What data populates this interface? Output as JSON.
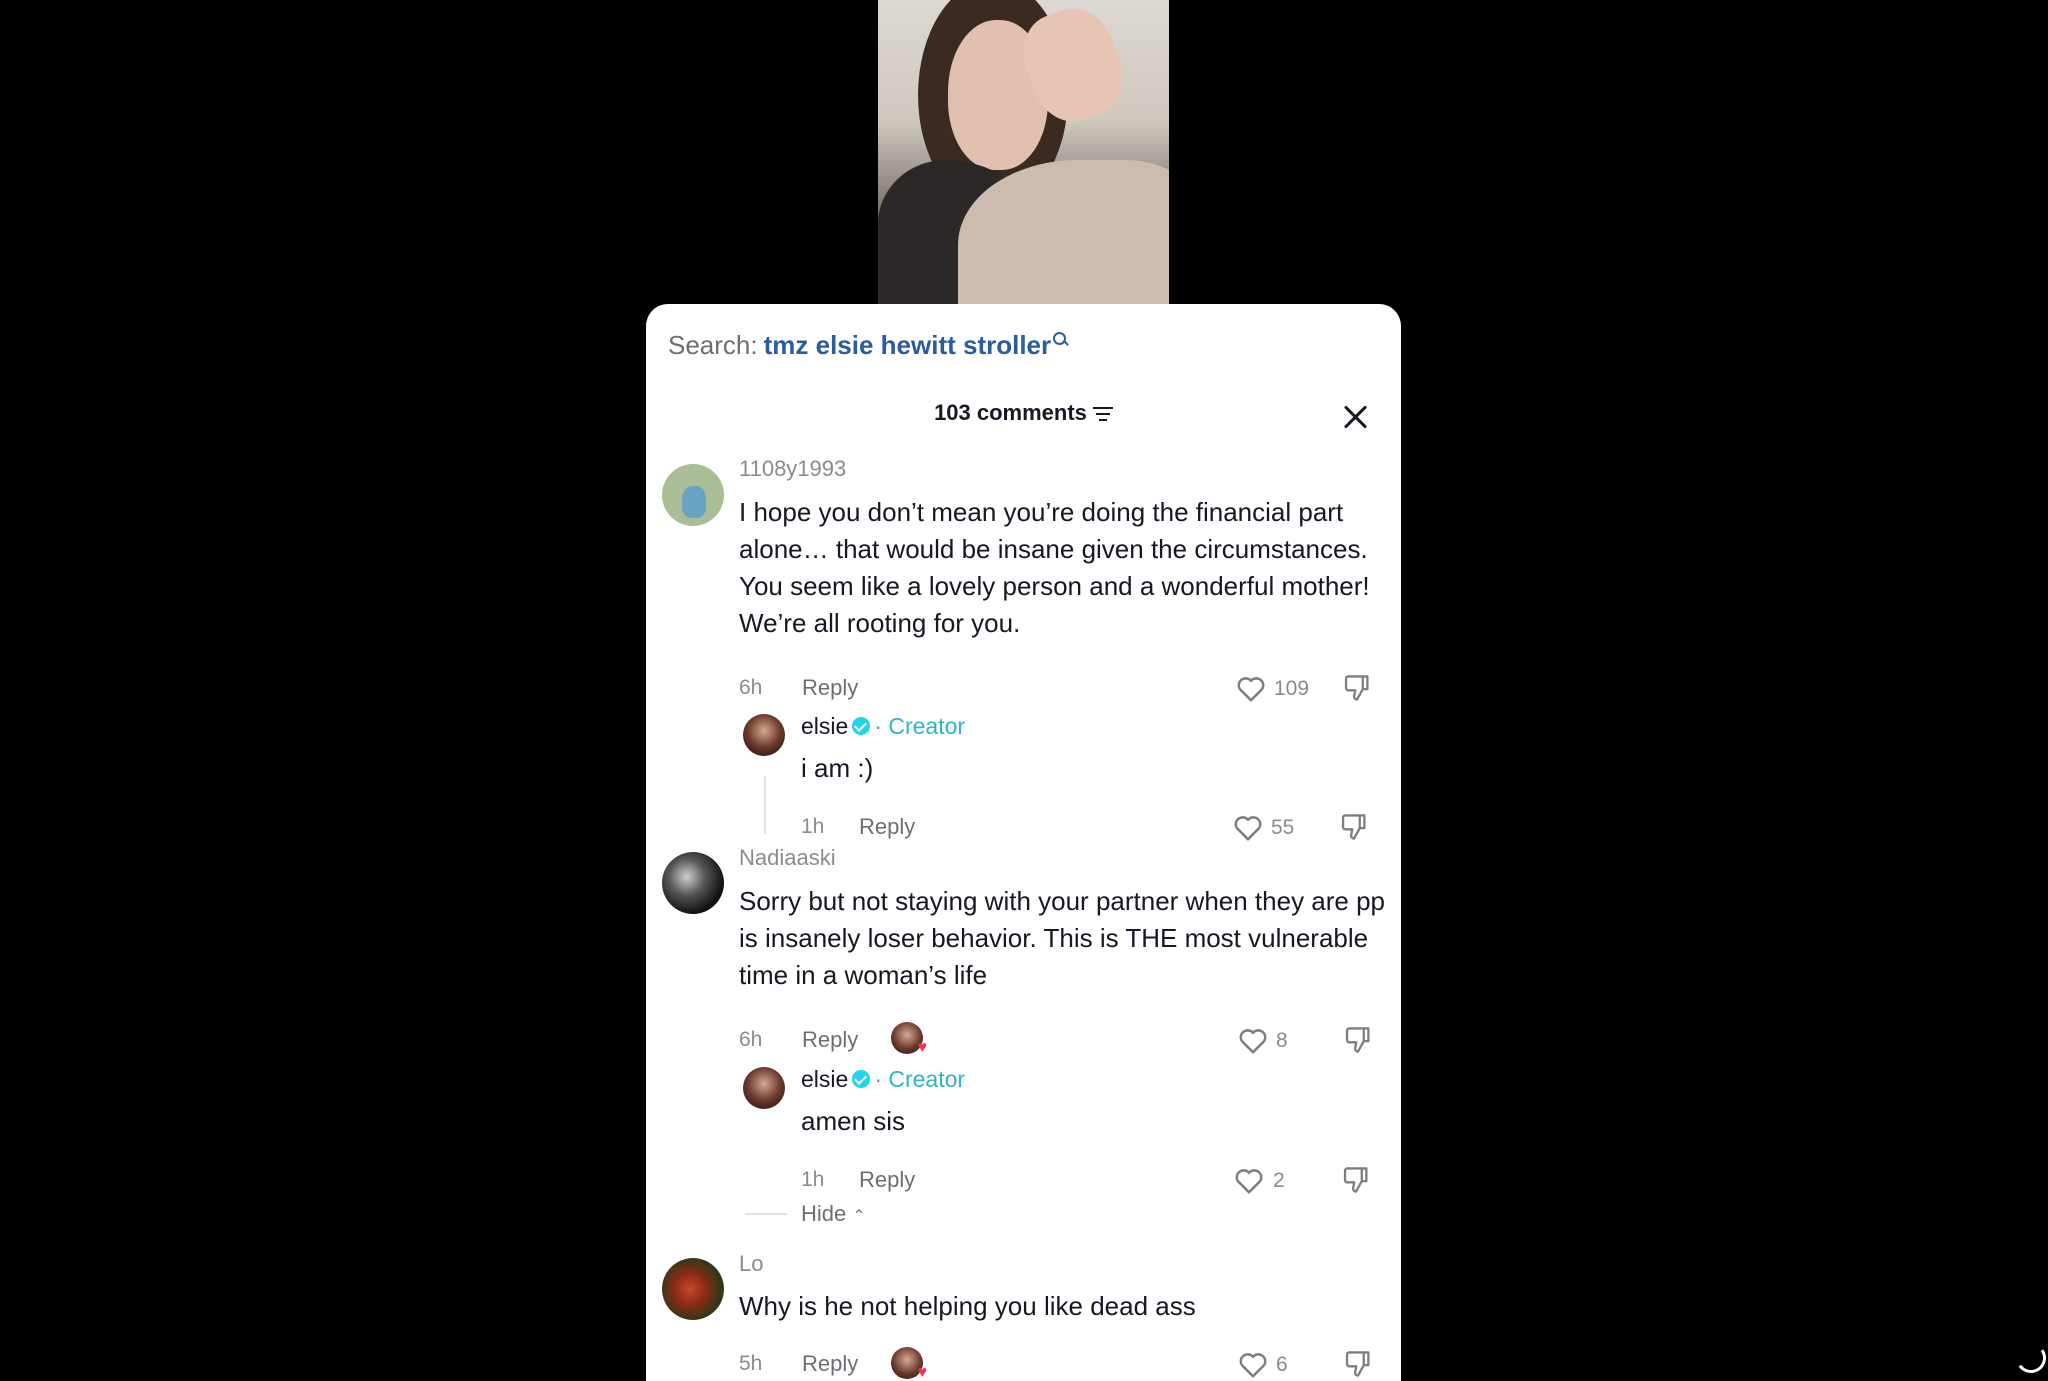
{
  "search": {
    "label": "Search:",
    "term": "tmz elsie hewitt stroller"
  },
  "header": {
    "count": "103 comments"
  },
  "comments": [
    {
      "username": "1108y1993",
      "text": "I hope you don’t mean you’re doing the financial part alone… that would be insane given the circumstances. You seem like a lovely person and a wonderful mother! We’re all rooting for you.",
      "time": "6h",
      "reply_label": "Reply",
      "likes": "109",
      "reply": {
        "username": "elsie",
        "tag": "Creator",
        "text": "i am :)",
        "time": "1h",
        "reply_label": "Reply",
        "likes": "55"
      }
    },
    {
      "username": "Nadiaaski",
      "text": "Sorry but not staying with your partner when they are pp is insanely loser behavior. This is THE most vulnerable time in a woman’s life",
      "time": "6h",
      "reply_label": "Reply",
      "likes": "8",
      "reply": {
        "username": "elsie",
        "tag": "Creator",
        "text": "amen sis",
        "time": "1h",
        "reply_label": "Reply",
        "likes": "2"
      },
      "hide_label": "Hide"
    },
    {
      "username": "Lo",
      "text": "Why is he not helping you like dead ass",
      "time": "5h",
      "reply_label": "Reply",
      "likes": "6"
    }
  ],
  "icons": {
    "heart": "heart-icon",
    "dislike": "dislike-icon",
    "filter": "filter-icon",
    "close": "close-icon",
    "verified": "verified-badge-icon"
  },
  "colors": {
    "accent": "#2a5d9b",
    "creator": "#2fb4c7",
    "text": "#161823",
    "muted": "#8a8b91"
  }
}
